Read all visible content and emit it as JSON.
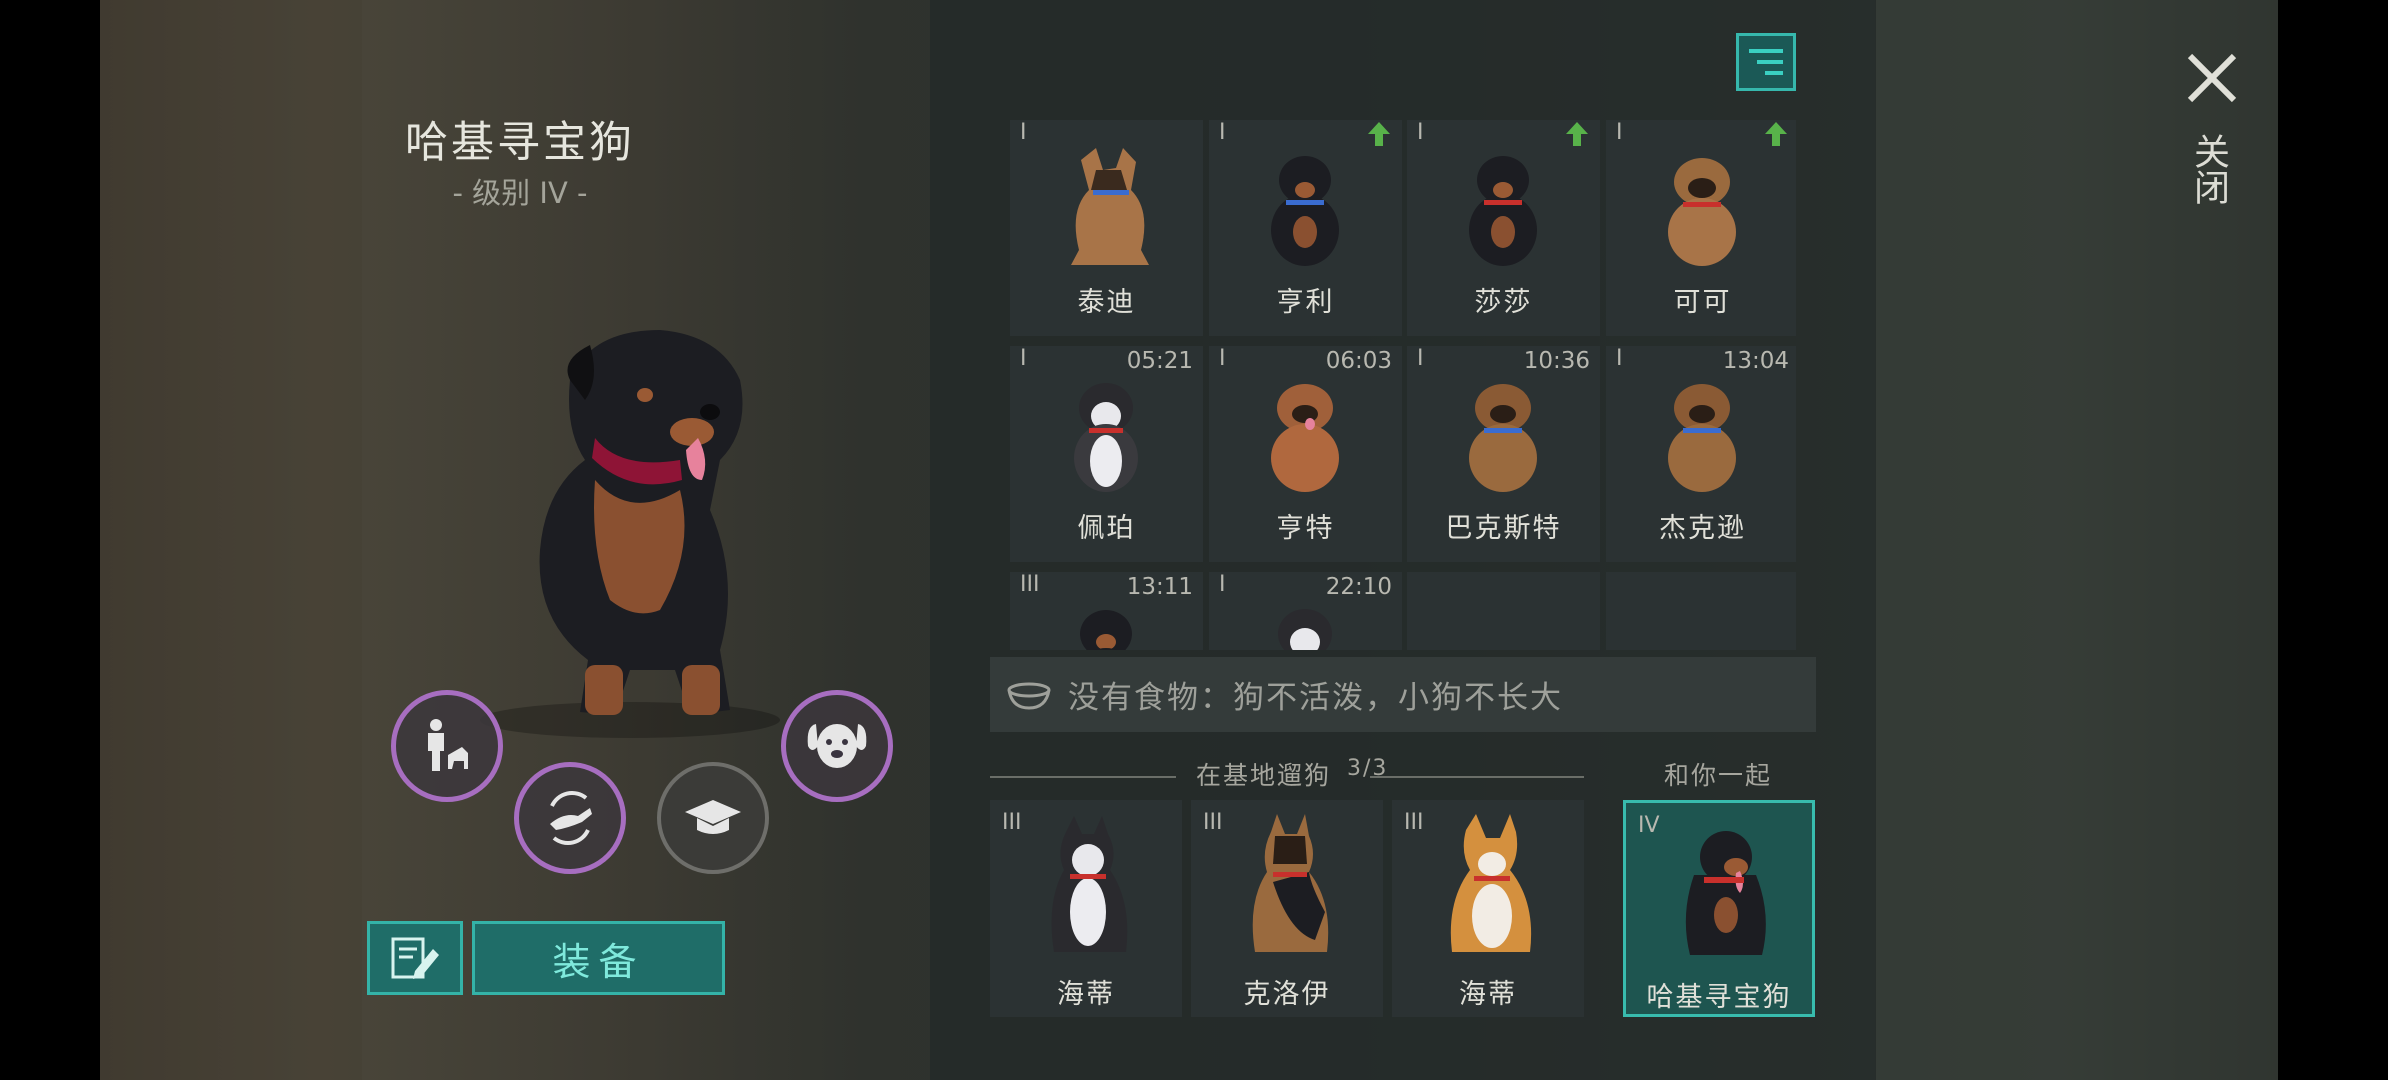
{
  "left": {
    "dog_name": "哈基寻宝狗",
    "dog_level": "- 级别 IV -",
    "actions": [
      {
        "icon": "trainer-icon"
      },
      {
        "icon": "agility-icon"
      },
      {
        "icon": "graduation-cap-icon"
      },
      {
        "icon": "dog-face-icon"
      }
    ],
    "edit_icon": "edit-note-icon",
    "equip_label": "装备"
  },
  "header": {
    "filter_icon": "filter-icon",
    "close_icon": "close-icon",
    "close_label": "关闭"
  },
  "grid": {
    "items": [
      {
        "tier": "I",
        "name": "泰迪",
        "upgrade": true,
        "time": ""
      },
      {
        "tier": "I",
        "name": "亨利",
        "upgrade": true,
        "time": ""
      },
      {
        "tier": "I",
        "name": "莎莎",
        "upgrade": true,
        "time": ""
      },
      {
        "tier": "I",
        "name": "可可",
        "upgrade": true,
        "time": ""
      },
      {
        "tier": "I",
        "name": "佩珀",
        "upgrade": false,
        "time": "05:21"
      },
      {
        "tier": "I",
        "name": "亨特",
        "upgrade": false,
        "time": "06:03"
      },
      {
        "tier": "I",
        "name": "巴克斯特",
        "upgrade": false,
        "time": "10:36"
      },
      {
        "tier": "I",
        "name": "杰克逊",
        "upgrade": false,
        "time": "13:04"
      },
      {
        "tier": "III",
        "name": "",
        "upgrade": false,
        "time": "13:11"
      },
      {
        "tier": "I",
        "name": "",
        "upgrade": false,
        "time": "22:10"
      }
    ]
  },
  "food_bar": {
    "icon": "food-bowl-icon",
    "text": "没有食物：狗不活泼，小狗不长大"
  },
  "base": {
    "label": "在基地遛狗",
    "count": "3/3",
    "dogs": [
      {
        "tier": "III",
        "name": "海蒂"
      },
      {
        "tier": "III",
        "name": "克洛伊"
      },
      {
        "tier": "III",
        "name": "海蒂"
      }
    ]
  },
  "with_you": {
    "label": "和你一起",
    "dog": {
      "tier": "IV",
      "name": "哈基寻宝狗"
    }
  },
  "colors": {
    "accent": "#36b8ad",
    "purple_ring": "#a76ec0",
    "upgrade_arrow": "#58b24a"
  }
}
